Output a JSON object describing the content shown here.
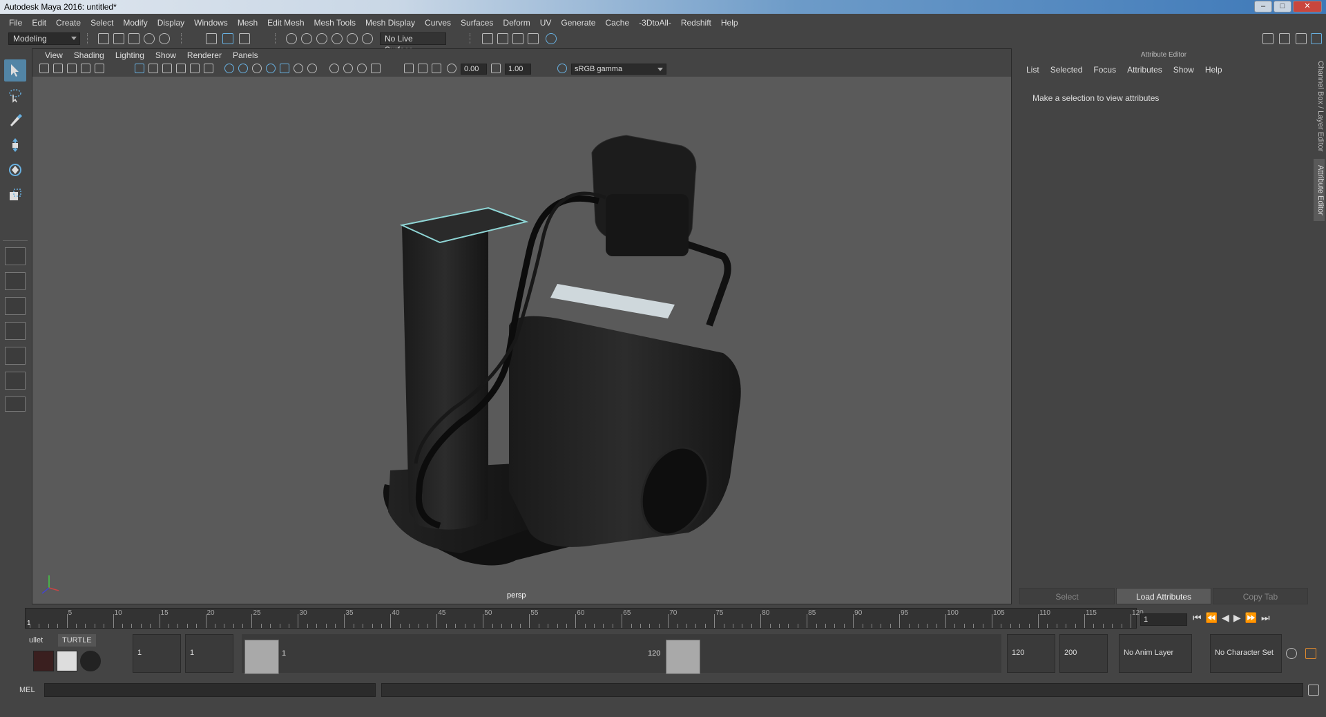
{
  "window": {
    "title": "Autodesk Maya 2016: untitled*",
    "minimize": "–",
    "maximize": "□",
    "close": "✕"
  },
  "menu": [
    "File",
    "Edit",
    "Create",
    "Select",
    "Modify",
    "Display",
    "Windows",
    "Mesh",
    "Edit Mesh",
    "Mesh Tools",
    "Mesh Display",
    "Curves",
    "Surfaces",
    "Deform",
    "UV",
    "Generate",
    "Cache",
    "-3DtoAll-",
    "Redshift",
    "Help"
  ],
  "toolbar": {
    "mode": "Modeling",
    "live_surface": "No Live Surface"
  },
  "panel": {
    "menu": [
      "View",
      "Shading",
      "Lighting",
      "Show",
      "Renderer",
      "Panels"
    ],
    "exposure": "0.00",
    "gamma": "1.00",
    "color_space": "sRGB gamma",
    "camera": "persp"
  },
  "attribute_editor": {
    "title": "Attribute Editor",
    "menu": [
      "List",
      "Selected",
      "Focus",
      "Attributes",
      "Show",
      "Help"
    ],
    "message": "Make a selection to view attributes",
    "buttons": [
      "Select",
      "Load Attributes",
      "Copy Tab"
    ]
  },
  "side_tabs": [
    "Channel Box / Layer Editor",
    "Attribute Editor"
  ],
  "timeline": {
    "ticks": [
      "5",
      "10",
      "15",
      "20",
      "25",
      "30",
      "35",
      "40",
      "45",
      "50",
      "55",
      "60",
      "65",
      "70",
      "75",
      "80",
      "85",
      "90",
      "95",
      "100",
      "105",
      "110",
      "115",
      "120"
    ],
    "first": "1",
    "current_frame": "1",
    "controls": [
      "⏮",
      "⏪",
      "◀",
      "▶",
      "⏩",
      "⏭"
    ]
  },
  "range": {
    "start": "1",
    "start_inner": "1",
    "slider_start": "1",
    "slider_end": "120",
    "end_inner": "120",
    "end": "200",
    "anim_layer": "No Anim Layer",
    "char_set": "No Character Set"
  },
  "shelf_tabs": {
    "bullet": "ullet",
    "turtle": "TURTLE"
  },
  "command_line": {
    "label": "MEL"
  },
  "colors": {
    "viewport_bg": "#5a5a5a",
    "ui_bg": "#444444",
    "accent": "#5285a6"
  }
}
